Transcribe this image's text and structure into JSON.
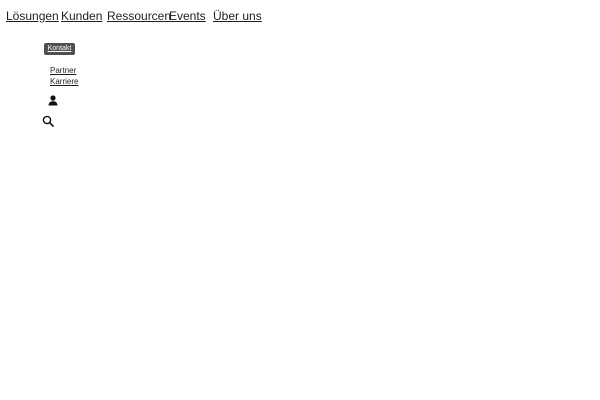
{
  "header": {
    "nav_items": [
      {
        "label": "Lösungen"
      },
      {
        "label": "Kunden"
      },
      {
        "label": "Ressourcen"
      },
      {
        "label": "Events"
      },
      {
        "label": "Über uns"
      }
    ],
    "contact_button": "Kontakt",
    "secondary_links": [
      {
        "label": "Partner"
      },
      {
        "label": "Karriere"
      }
    ],
    "icons": {
      "user": "user-icon",
      "search": "search-icon"
    },
    "colors": {
      "text": "#1f1f1f",
      "button_background": "#4b5054",
      "button_text": "#ffffff"
    }
  }
}
